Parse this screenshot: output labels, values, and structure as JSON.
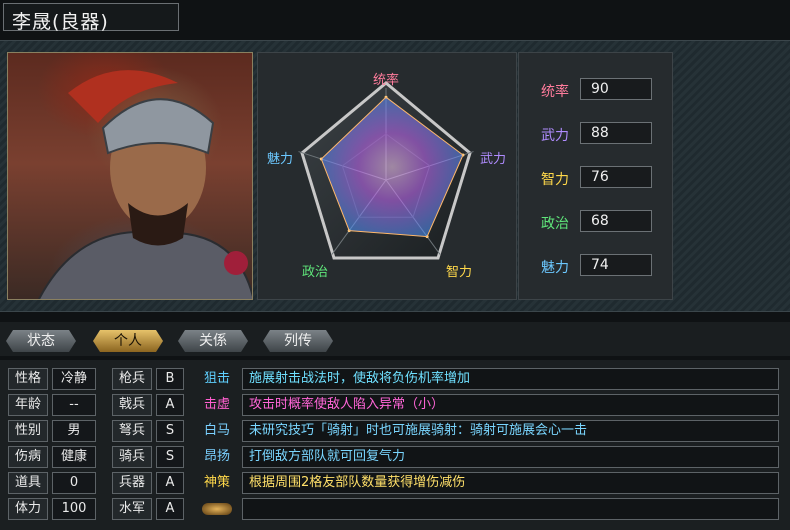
{
  "header": {
    "title": "李晟(良器)"
  },
  "radar": {
    "labels": {
      "lead": "统率",
      "war": "武力",
      "int": "智力",
      "pol": "政治",
      "cha": "魅力"
    },
    "colors": {
      "lead": "#ff7c9c",
      "war": "#b08cff",
      "int": "#ffd84a",
      "pol": "#5fe67a",
      "cha": "#6cc8ff"
    }
  },
  "chart_data": {
    "type": "radar",
    "axes": [
      "统率",
      "武力",
      "智力",
      "政治",
      "魅力"
    ],
    "values": [
      90,
      88,
      76,
      68,
      74
    ],
    "range": [
      0,
      100
    ]
  },
  "stats": [
    {
      "label": "统率",
      "value": "90",
      "color": "#ff7c9c"
    },
    {
      "label": "武力",
      "value": "88",
      "color": "#b08cff"
    },
    {
      "label": "智力",
      "value": "76",
      "color": "#ffd84a"
    },
    {
      "label": "政治",
      "value": "68",
      "color": "#5fe67a"
    },
    {
      "label": "魅力",
      "value": "74",
      "color": "#6cc8ff"
    }
  ],
  "tabs": [
    {
      "label": "状态",
      "active": false
    },
    {
      "label": "个人",
      "active": true
    },
    {
      "label": "关係",
      "active": false
    },
    {
      "label": "列传",
      "active": false
    }
  ],
  "personal": [
    {
      "label": "性格",
      "value": "冷静"
    },
    {
      "label": "年龄",
      "value": "--"
    },
    {
      "label": "性别",
      "value": "男"
    },
    {
      "label": "伤病",
      "value": "健康"
    },
    {
      "label": "道具",
      "value": "0"
    },
    {
      "label": "体力",
      "value": "100"
    }
  ],
  "aptitudes": [
    {
      "label": "枪兵",
      "value": "B"
    },
    {
      "label": "戟兵",
      "value": "A"
    },
    {
      "label": "弩兵",
      "value": "S"
    },
    {
      "label": "骑兵",
      "value": "S"
    },
    {
      "label": "兵器",
      "value": "A"
    },
    {
      "label": "水军",
      "value": "A"
    }
  ],
  "skills": [
    {
      "name": "狙击",
      "color": "#5fd0ff",
      "desc": "施展射击战法时，使敌将负伤机率增加",
      "desc_color": "#6fe0ff"
    },
    {
      "name": "击虚",
      "color": "#ff5fcf",
      "desc": "攻击时概率使敌人陷入异常（小）",
      "desc_color": "#ff66d8"
    },
    {
      "name": "白马",
      "color": "#7ad0ff",
      "desc": "未研究技巧「骑射」时也可施展骑射：骑射可施展会心一击",
      "desc_color": "#7ad6ff"
    },
    {
      "name": "昂扬",
      "color": "#7ad0ff",
      "desc": "打倒敌方部队就可回复气力",
      "desc_color": "#7ad6ff"
    },
    {
      "name": "神策",
      "color": "#ffd84a",
      "desc": "根据周围2格友部队数量获得增伤减伤",
      "desc_color": "#ffe06a"
    },
    {
      "name": "",
      "color": "#d9a24a",
      "desc": "",
      "desc_color": "#ffffff"
    }
  ]
}
